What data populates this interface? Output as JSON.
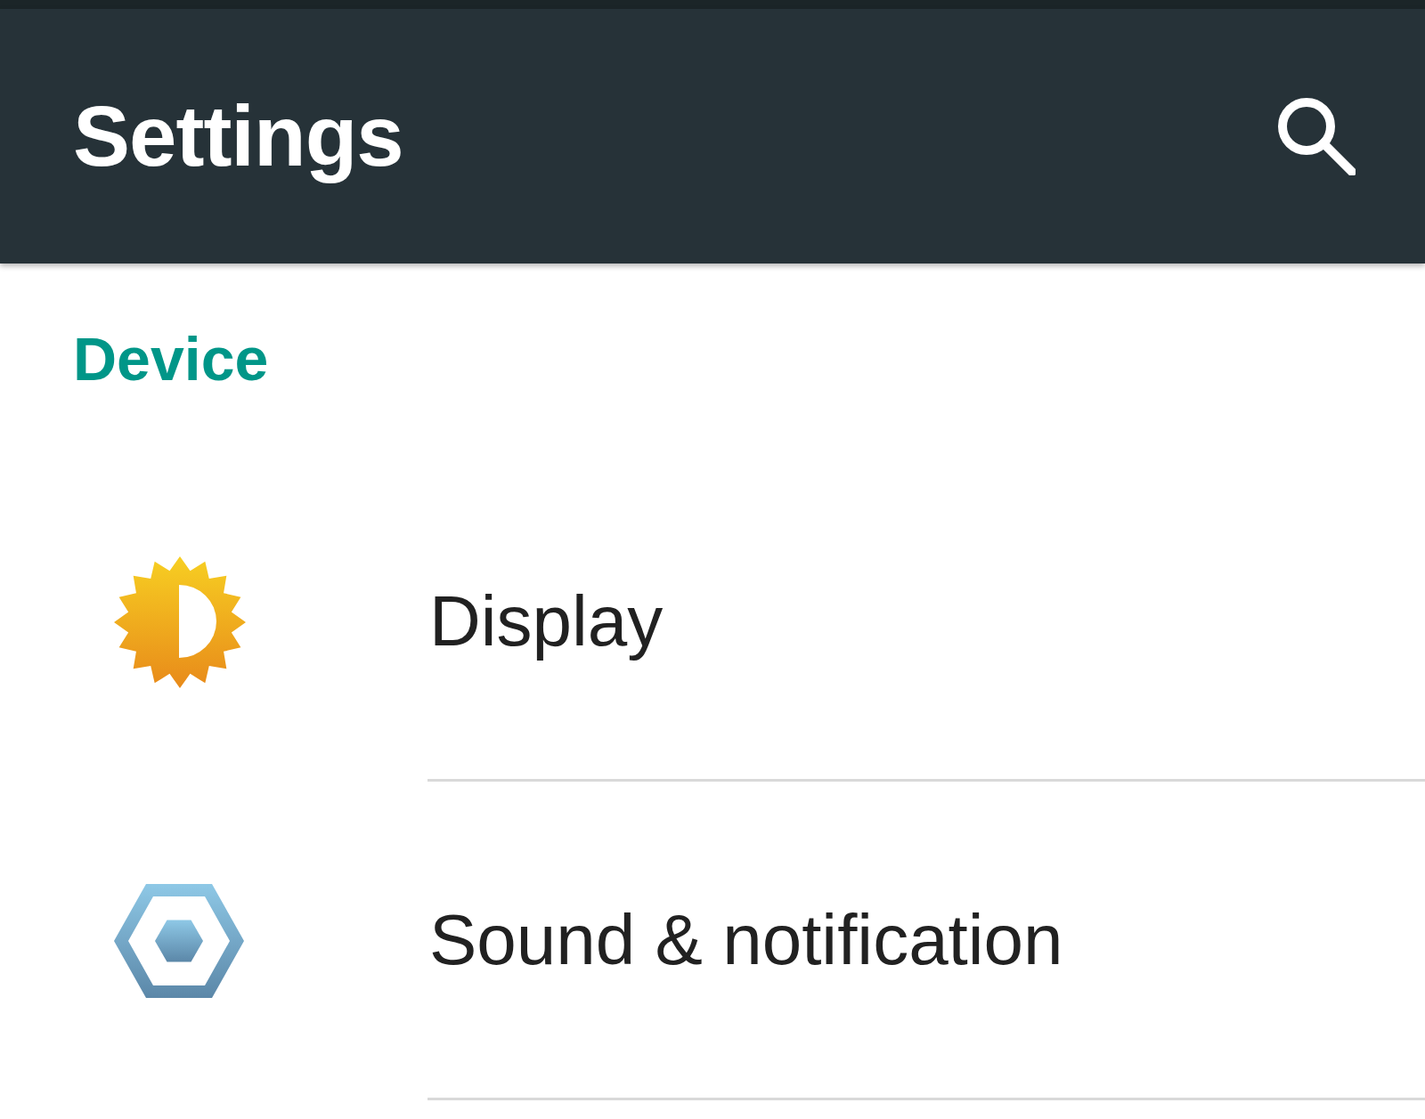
{
  "app_bar": {
    "title": "Settings"
  },
  "sections": [
    {
      "header": "Device",
      "items": [
        {
          "label": "Display",
          "kind": "display"
        },
        {
          "label": "Sound & notification",
          "kind": "sound"
        }
      ]
    }
  ]
}
